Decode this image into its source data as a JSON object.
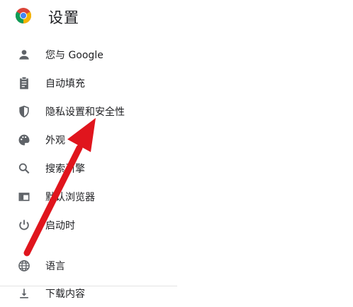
{
  "header": {
    "title": "设置",
    "logo_icon": "chrome-logo-icon"
  },
  "sidebar": {
    "items": [
      {
        "label": "您与 Google",
        "icon": "person-icon"
      },
      {
        "label": "自动填充",
        "icon": "clipboard-icon"
      },
      {
        "label": "隐私设置和安全性",
        "icon": "shield-icon"
      },
      {
        "label": "外观",
        "icon": "palette-icon"
      },
      {
        "label": "搜索引擎",
        "icon": "search-icon"
      },
      {
        "label": "默认浏览器",
        "icon": "browser-window-icon"
      },
      {
        "label": "启动时",
        "icon": "power-icon"
      },
      {
        "label": "语言",
        "icon": "globe-icon"
      },
      {
        "label": "下载内容",
        "icon": "download-icon"
      }
    ]
  },
  "annotation": {
    "color": "#e0151d"
  }
}
